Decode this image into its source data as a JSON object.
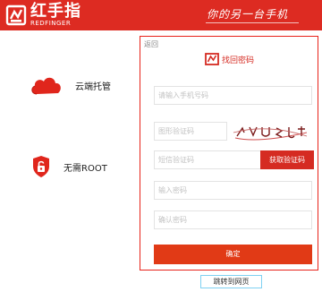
{
  "header": {
    "brand_cn": "红手指",
    "brand_en": "REDFINGER",
    "slogan": "你的另一台手机",
    "background_color": "#dd2b22"
  },
  "features": [
    {
      "label": "云端托管",
      "icon": "cloud-icon",
      "color": "#e0261c"
    },
    {
      "label": "无需ROOT",
      "icon": "unlock-shield-icon",
      "color": "#e0261c"
    }
  ],
  "form": {
    "back_label": "返回",
    "title": "找回密码",
    "title_icon": "reset-password-icon",
    "phone_placeholder": "请输入手机号码",
    "captcha_placeholder": "图形验证码",
    "captcha_icon": "captcha-image",
    "sms_placeholder": "短信验证码",
    "sms_button": "获取验证码",
    "password_placeholder": "输入密码",
    "confirm_placeholder": "确认密码",
    "submit_label": "确定",
    "accent_color": "#d52b22",
    "border_color": "#e8231a"
  },
  "jump_link": "跳转到网页"
}
